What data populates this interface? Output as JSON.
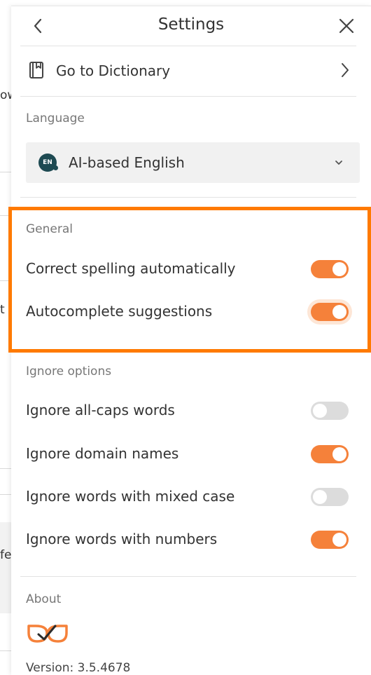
{
  "background": {
    "fragments": [
      "ow",
      "t",
      "fe"
    ]
  },
  "header": {
    "title": "Settings"
  },
  "dictionary": {
    "label": "Go to Dictionary"
  },
  "language": {
    "section_title": "Language",
    "badge": "EN",
    "selected": "AI-based English"
  },
  "general": {
    "section_title": "General",
    "options": [
      {
        "label": "Correct spelling automatically",
        "enabled": true
      },
      {
        "label": "Autocomplete suggestions",
        "enabled": true
      }
    ]
  },
  "ignore": {
    "section_title": "Ignore options",
    "options": [
      {
        "label": "Ignore all-caps words",
        "enabled": false
      },
      {
        "label": "Ignore domain names",
        "enabled": true
      },
      {
        "label": "Ignore words with mixed case",
        "enabled": false
      },
      {
        "label": "Ignore words with numbers",
        "enabled": true
      }
    ]
  },
  "about": {
    "section_title": "About",
    "version": "Version: 3.5.4678"
  },
  "colors": {
    "accent": "#f5813a",
    "highlight_border": "#ff7a00",
    "toggle_off": "#dcdcdc",
    "language_badge": "#1e4a52"
  },
  "icons": {
    "back": "chevron-left-icon",
    "close": "close-icon",
    "dictionary": "book-icon",
    "dictionary_chevron": "chevron-right-icon",
    "language_dropdown": "chevron-down-icon",
    "logo": "languagetool-logo-icon"
  }
}
